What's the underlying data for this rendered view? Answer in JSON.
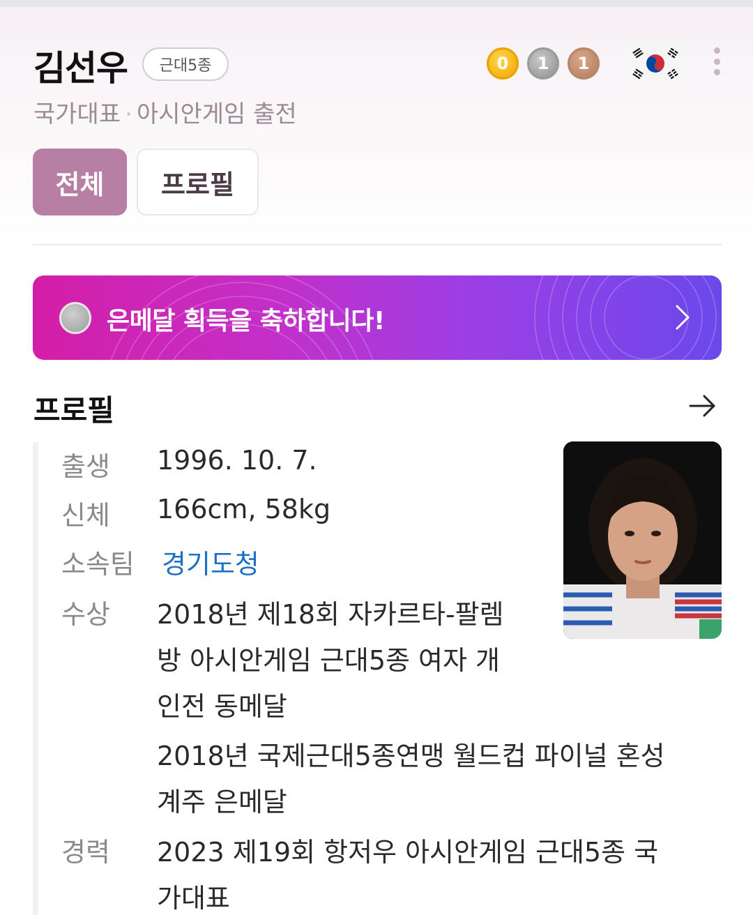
{
  "athlete": {
    "name": "김선우",
    "sport_badge": "근대5종",
    "subtitle_left": "국가대표",
    "subtitle_sep": "·",
    "subtitle_right": "아시안게임 출전"
  },
  "medals": {
    "gold": "0",
    "silver": "1",
    "bronze": "1",
    "colors": {
      "gold": "#f0a500",
      "silver": "#9a9a9a",
      "bronze": "#b27b5e"
    }
  },
  "tabs": [
    {
      "label": "전체",
      "active": true
    },
    {
      "label": "프로필",
      "active": false
    }
  ],
  "banner": {
    "text": "은메달 획득을 축하합니다!",
    "colors": [
      "#d41ea8",
      "#9a3fe6",
      "#6b48ea"
    ]
  },
  "profile": {
    "title": "프로필",
    "birth": {
      "label": "출생",
      "value": "1996. 10. 7."
    },
    "body": {
      "label": "신체",
      "value": "166cm, 58kg"
    },
    "team": {
      "label": "소속팀",
      "value": "경기도청"
    },
    "awards": {
      "label": "수상",
      "lines": [
        "2018년 제18회 자카르타-팔렘",
        "방 아시안게임 근대5종 여자 개",
        "인전 동메달",
        "2018년 국제근대5종연맹 월드컵 파이널 혼성",
        "계주 은메달"
      ]
    },
    "career": {
      "label": "경력",
      "lines": [
        "2023 제19회 항저우 아시안게임 근대5종 국",
        "가대표"
      ]
    }
  },
  "icons": {
    "flag": "south-korea-flag-icon",
    "more": "kebab-menu-icon",
    "arrow": "arrow-right-icon",
    "chevron": "chevron-right-icon",
    "medal": "silver-medal-icon"
  }
}
